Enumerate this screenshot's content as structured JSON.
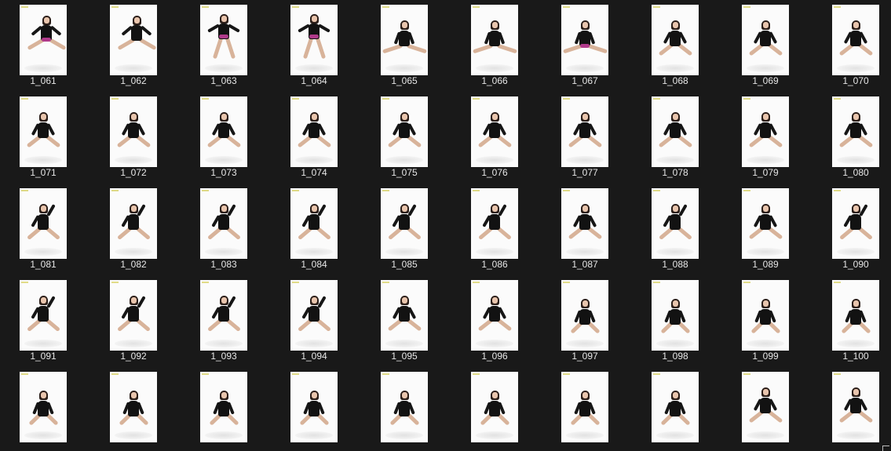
{
  "gallery": {
    "items": [
      {
        "name": "1_061",
        "pose": "recline-left",
        "skirt": true
      },
      {
        "name": "1_062",
        "pose": "recline-left",
        "skirt": false
      },
      {
        "name": "1_063",
        "pose": "seated-knees",
        "skirt": true
      },
      {
        "name": "1_064",
        "pose": "seated-knees",
        "skirt": true
      },
      {
        "name": "1_065",
        "pose": "split",
        "skirt": false
      },
      {
        "name": "1_066",
        "pose": "split",
        "skirt": false
      },
      {
        "name": "1_067",
        "pose": "split",
        "skirt": true
      },
      {
        "name": "1_068",
        "pose": "crouch-wide",
        "skirt": false
      },
      {
        "name": "1_069",
        "pose": "crouch-wide",
        "skirt": false
      },
      {
        "name": "1_070",
        "pose": "crouch-wide",
        "skirt": false
      },
      {
        "name": "1_071",
        "pose": "crouch-wide",
        "skirt": false
      },
      {
        "name": "1_072",
        "pose": "crouch-wide",
        "skirt": false
      },
      {
        "name": "1_073",
        "pose": "crouch-wide",
        "skirt": false
      },
      {
        "name": "1_074",
        "pose": "crouch-wide",
        "skirt": false
      },
      {
        "name": "1_075",
        "pose": "crouch-wide",
        "skirt": false
      },
      {
        "name": "1_076",
        "pose": "crouch-wide",
        "skirt": false
      },
      {
        "name": "1_077",
        "pose": "crouch-wide",
        "skirt": false
      },
      {
        "name": "1_078",
        "pose": "crouch-wide",
        "skirt": false
      },
      {
        "name": "1_079",
        "pose": "crouch-wide",
        "skirt": false
      },
      {
        "name": "1_080",
        "pose": "crouch-wide",
        "skirt": false
      },
      {
        "name": "1_081",
        "pose": "crouch-hand",
        "skirt": false
      },
      {
        "name": "1_082",
        "pose": "crouch-hand",
        "skirt": false
      },
      {
        "name": "1_083",
        "pose": "crouch-hand",
        "skirt": false
      },
      {
        "name": "1_084",
        "pose": "crouch-hand",
        "skirt": false
      },
      {
        "name": "1_085",
        "pose": "crouch-hand",
        "skirt": false
      },
      {
        "name": "1_086",
        "pose": "crouch-hand",
        "skirt": false
      },
      {
        "name": "1_087",
        "pose": "crouch-wide",
        "skirt": false
      },
      {
        "name": "1_088",
        "pose": "crouch-hand",
        "skirt": false
      },
      {
        "name": "1_089",
        "pose": "crouch-wide",
        "skirt": false
      },
      {
        "name": "1_090",
        "pose": "crouch-hand",
        "skirt": false
      },
      {
        "name": "1_091",
        "pose": "crouch-hand",
        "skirt": false
      },
      {
        "name": "1_092",
        "pose": "crouch-hand",
        "skirt": false
      },
      {
        "name": "1_093",
        "pose": "crouch-hand",
        "skirt": false
      },
      {
        "name": "1_094",
        "pose": "crouch-hand",
        "skirt": false
      },
      {
        "name": "1_095",
        "pose": "crouch-wide",
        "skirt": false
      },
      {
        "name": "1_096",
        "pose": "crouch-wide",
        "skirt": false
      },
      {
        "name": "1_097",
        "pose": "crouch-low",
        "skirt": false
      },
      {
        "name": "1_098",
        "pose": "crouch-low",
        "skirt": false
      },
      {
        "name": "1_099",
        "pose": "crouch-low",
        "skirt": false
      },
      {
        "name": "1_100",
        "pose": "crouch-low",
        "skirt": false
      },
      {
        "name": "",
        "pose": "crouch-low",
        "skirt": false
      },
      {
        "name": "",
        "pose": "crouch-low",
        "skirt": false
      },
      {
        "name": "",
        "pose": "crouch-low",
        "skirt": false
      },
      {
        "name": "",
        "pose": "crouch-low",
        "skirt": false
      },
      {
        "name": "",
        "pose": "crouch-low",
        "skirt": false
      },
      {
        "name": "",
        "pose": "crouch-low",
        "skirt": false
      },
      {
        "name": "",
        "pose": "crouch-low",
        "skirt": false
      },
      {
        "name": "",
        "pose": "crouch-low",
        "skirt": false
      },
      {
        "name": "",
        "pose": "crouch-wide",
        "skirt": false
      },
      {
        "name": "",
        "pose": "crouch-wide",
        "skirt": false
      }
    ]
  },
  "colors": {
    "background": "#191919",
    "label": "#e6e6e6",
    "photo_bg": "#fbfbfb",
    "outfit": "#121212",
    "skin": "#e9c5ad",
    "skirt_accent": "#b03a8a",
    "watermark": "#d9d36a"
  },
  "scroll_corner": {
    "icon": "chevron-corner-icon"
  }
}
